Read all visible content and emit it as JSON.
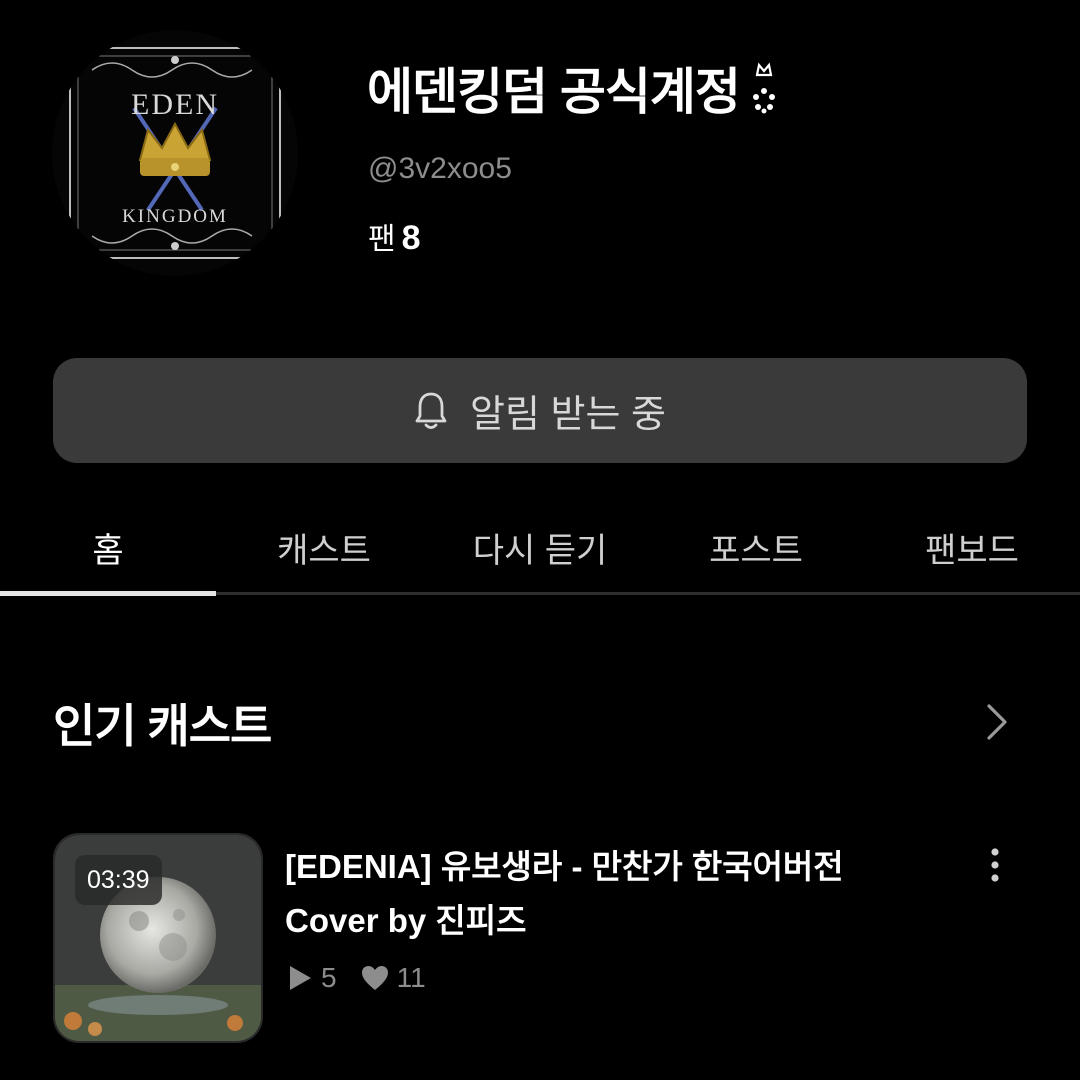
{
  "profile": {
    "avatar_lines": [
      "EDEN",
      "KINGDOM"
    ],
    "name": "에덴킹덤 공식계정",
    "badge_icon": "crown-badge-icon",
    "handle": "@3v2xoo5",
    "fans_label": "팬",
    "fans_count": "8"
  },
  "notify_button": {
    "icon": "bell-icon",
    "label": "알림 받는 중"
  },
  "tabs": [
    {
      "label": "홈",
      "active": true
    },
    {
      "label": "캐스트",
      "active": false
    },
    {
      "label": "다시 듣기",
      "active": false
    },
    {
      "label": "포스트",
      "active": false
    },
    {
      "label": "팬보드",
      "active": false
    }
  ],
  "popular": {
    "title": "인기 캐스트",
    "more_icon": "chevron-right-icon",
    "items": [
      {
        "duration": "03:39",
        "title_line1": "[EDENIA] 유보생라 - 만찬가 한국어버전",
        "title_line2": "Cover by 진피즈",
        "plays": "5",
        "likes": "11",
        "menu_icon": "more-vertical-icon"
      }
    ]
  },
  "colors": {
    "background": "#000000",
    "button_bg": "#3a3a3a",
    "muted_text": "#8d8d8d"
  }
}
